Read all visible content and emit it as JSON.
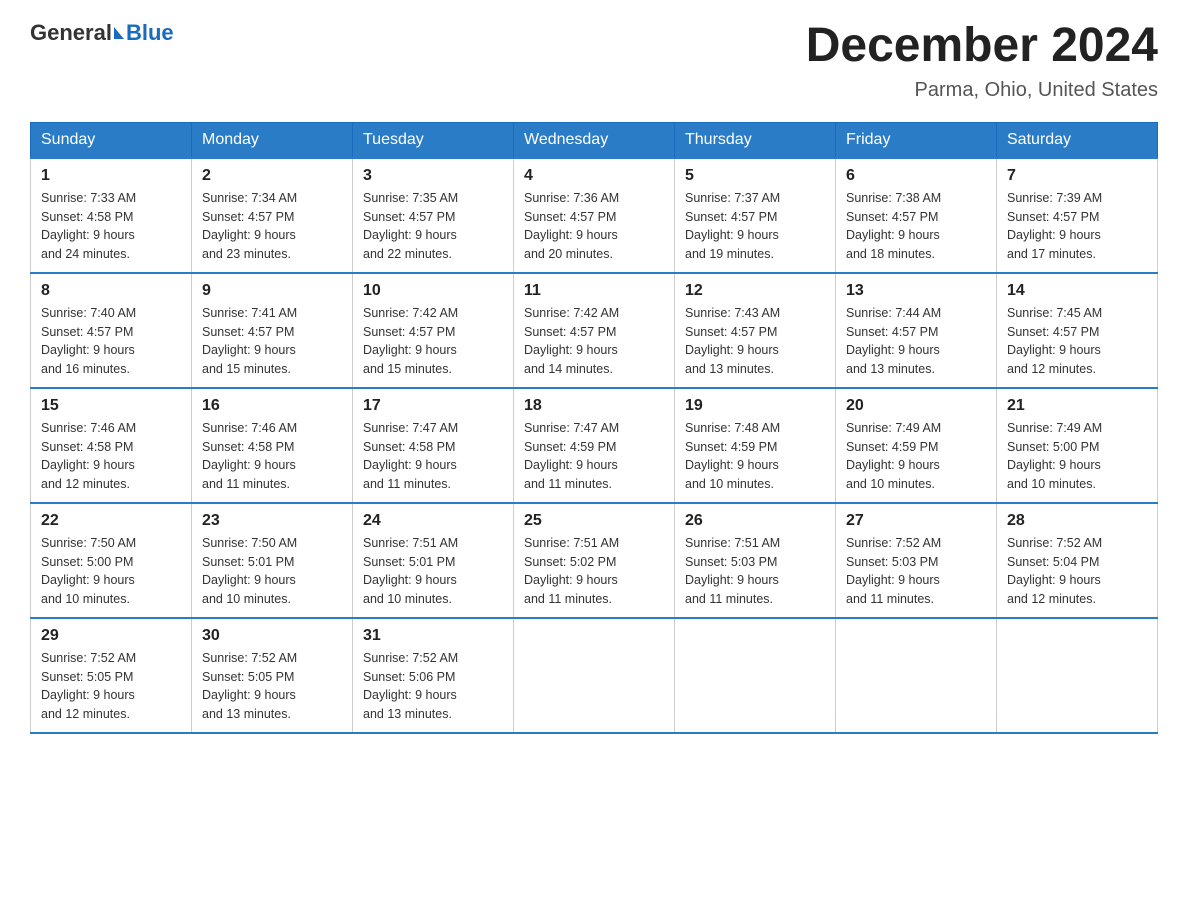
{
  "logo": {
    "general": "General",
    "blue": "Blue"
  },
  "title": "December 2024",
  "subtitle": "Parma, Ohio, United States",
  "weekdays": [
    "Sunday",
    "Monday",
    "Tuesday",
    "Wednesday",
    "Thursday",
    "Friday",
    "Saturday"
  ],
  "weeks": [
    [
      {
        "day": "1",
        "sunrise": "7:33 AM",
        "sunset": "4:58 PM",
        "daylight": "9 hours and 24 minutes."
      },
      {
        "day": "2",
        "sunrise": "7:34 AM",
        "sunset": "4:57 PM",
        "daylight": "9 hours and 23 minutes."
      },
      {
        "day": "3",
        "sunrise": "7:35 AM",
        "sunset": "4:57 PM",
        "daylight": "9 hours and 22 minutes."
      },
      {
        "day": "4",
        "sunrise": "7:36 AM",
        "sunset": "4:57 PM",
        "daylight": "9 hours and 20 minutes."
      },
      {
        "day": "5",
        "sunrise": "7:37 AM",
        "sunset": "4:57 PM",
        "daylight": "9 hours and 19 minutes."
      },
      {
        "day": "6",
        "sunrise": "7:38 AM",
        "sunset": "4:57 PM",
        "daylight": "9 hours and 18 minutes."
      },
      {
        "day": "7",
        "sunrise": "7:39 AM",
        "sunset": "4:57 PM",
        "daylight": "9 hours and 17 minutes."
      }
    ],
    [
      {
        "day": "8",
        "sunrise": "7:40 AM",
        "sunset": "4:57 PM",
        "daylight": "9 hours and 16 minutes."
      },
      {
        "day": "9",
        "sunrise": "7:41 AM",
        "sunset": "4:57 PM",
        "daylight": "9 hours and 15 minutes."
      },
      {
        "day": "10",
        "sunrise": "7:42 AM",
        "sunset": "4:57 PM",
        "daylight": "9 hours and 15 minutes."
      },
      {
        "day": "11",
        "sunrise": "7:42 AM",
        "sunset": "4:57 PM",
        "daylight": "9 hours and 14 minutes."
      },
      {
        "day": "12",
        "sunrise": "7:43 AM",
        "sunset": "4:57 PM",
        "daylight": "9 hours and 13 minutes."
      },
      {
        "day": "13",
        "sunrise": "7:44 AM",
        "sunset": "4:57 PM",
        "daylight": "9 hours and 13 minutes."
      },
      {
        "day": "14",
        "sunrise": "7:45 AM",
        "sunset": "4:57 PM",
        "daylight": "9 hours and 12 minutes."
      }
    ],
    [
      {
        "day": "15",
        "sunrise": "7:46 AM",
        "sunset": "4:58 PM",
        "daylight": "9 hours and 12 minutes."
      },
      {
        "day": "16",
        "sunrise": "7:46 AM",
        "sunset": "4:58 PM",
        "daylight": "9 hours and 11 minutes."
      },
      {
        "day": "17",
        "sunrise": "7:47 AM",
        "sunset": "4:58 PM",
        "daylight": "9 hours and 11 minutes."
      },
      {
        "day": "18",
        "sunrise": "7:47 AM",
        "sunset": "4:59 PM",
        "daylight": "9 hours and 11 minutes."
      },
      {
        "day": "19",
        "sunrise": "7:48 AM",
        "sunset": "4:59 PM",
        "daylight": "9 hours and 10 minutes."
      },
      {
        "day": "20",
        "sunrise": "7:49 AM",
        "sunset": "4:59 PM",
        "daylight": "9 hours and 10 minutes."
      },
      {
        "day": "21",
        "sunrise": "7:49 AM",
        "sunset": "5:00 PM",
        "daylight": "9 hours and 10 minutes."
      }
    ],
    [
      {
        "day": "22",
        "sunrise": "7:50 AM",
        "sunset": "5:00 PM",
        "daylight": "9 hours and 10 minutes."
      },
      {
        "day": "23",
        "sunrise": "7:50 AM",
        "sunset": "5:01 PM",
        "daylight": "9 hours and 10 minutes."
      },
      {
        "day": "24",
        "sunrise": "7:51 AM",
        "sunset": "5:01 PM",
        "daylight": "9 hours and 10 minutes."
      },
      {
        "day": "25",
        "sunrise": "7:51 AM",
        "sunset": "5:02 PM",
        "daylight": "9 hours and 11 minutes."
      },
      {
        "day": "26",
        "sunrise": "7:51 AM",
        "sunset": "5:03 PM",
        "daylight": "9 hours and 11 minutes."
      },
      {
        "day": "27",
        "sunrise": "7:52 AM",
        "sunset": "5:03 PM",
        "daylight": "9 hours and 11 minutes."
      },
      {
        "day": "28",
        "sunrise": "7:52 AM",
        "sunset": "5:04 PM",
        "daylight": "9 hours and 12 minutes."
      }
    ],
    [
      {
        "day": "29",
        "sunrise": "7:52 AM",
        "sunset": "5:05 PM",
        "daylight": "9 hours and 12 minutes."
      },
      {
        "day": "30",
        "sunrise": "7:52 AM",
        "sunset": "5:05 PM",
        "daylight": "9 hours and 13 minutes."
      },
      {
        "day": "31",
        "sunrise": "7:52 AM",
        "sunset": "5:06 PM",
        "daylight": "9 hours and 13 minutes."
      },
      null,
      null,
      null,
      null
    ]
  ],
  "labels": {
    "sunrise": "Sunrise:",
    "sunset": "Sunset:",
    "daylight": "Daylight:"
  }
}
